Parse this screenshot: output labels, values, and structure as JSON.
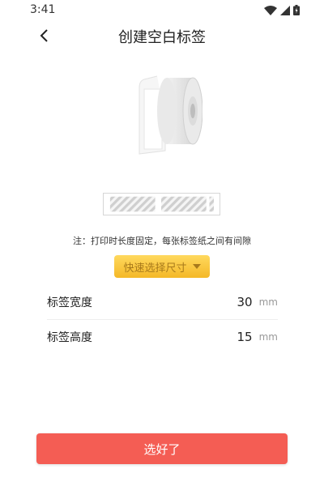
{
  "status_bar": {
    "time": "3:41"
  },
  "header": {
    "title": "创建空白标签"
  },
  "note": "注：打印时长度固定，每张标签纸之间有间隙",
  "quick_select": {
    "label": "快速选择尺寸"
  },
  "fields": [
    {
      "label": "标签宽度",
      "value": "30",
      "unit": "mm"
    },
    {
      "label": "标签高度",
      "value": "15",
      "unit": "mm"
    }
  ],
  "confirm_button": {
    "label": "选好了"
  },
  "colors": {
    "accent": "#f45d54",
    "quick_button": "#f4b827"
  },
  "icons": {
    "back": "chevron-left-icon",
    "wifi": "wifi-icon",
    "signal": "signal-icon",
    "battery": "battery-icon"
  }
}
